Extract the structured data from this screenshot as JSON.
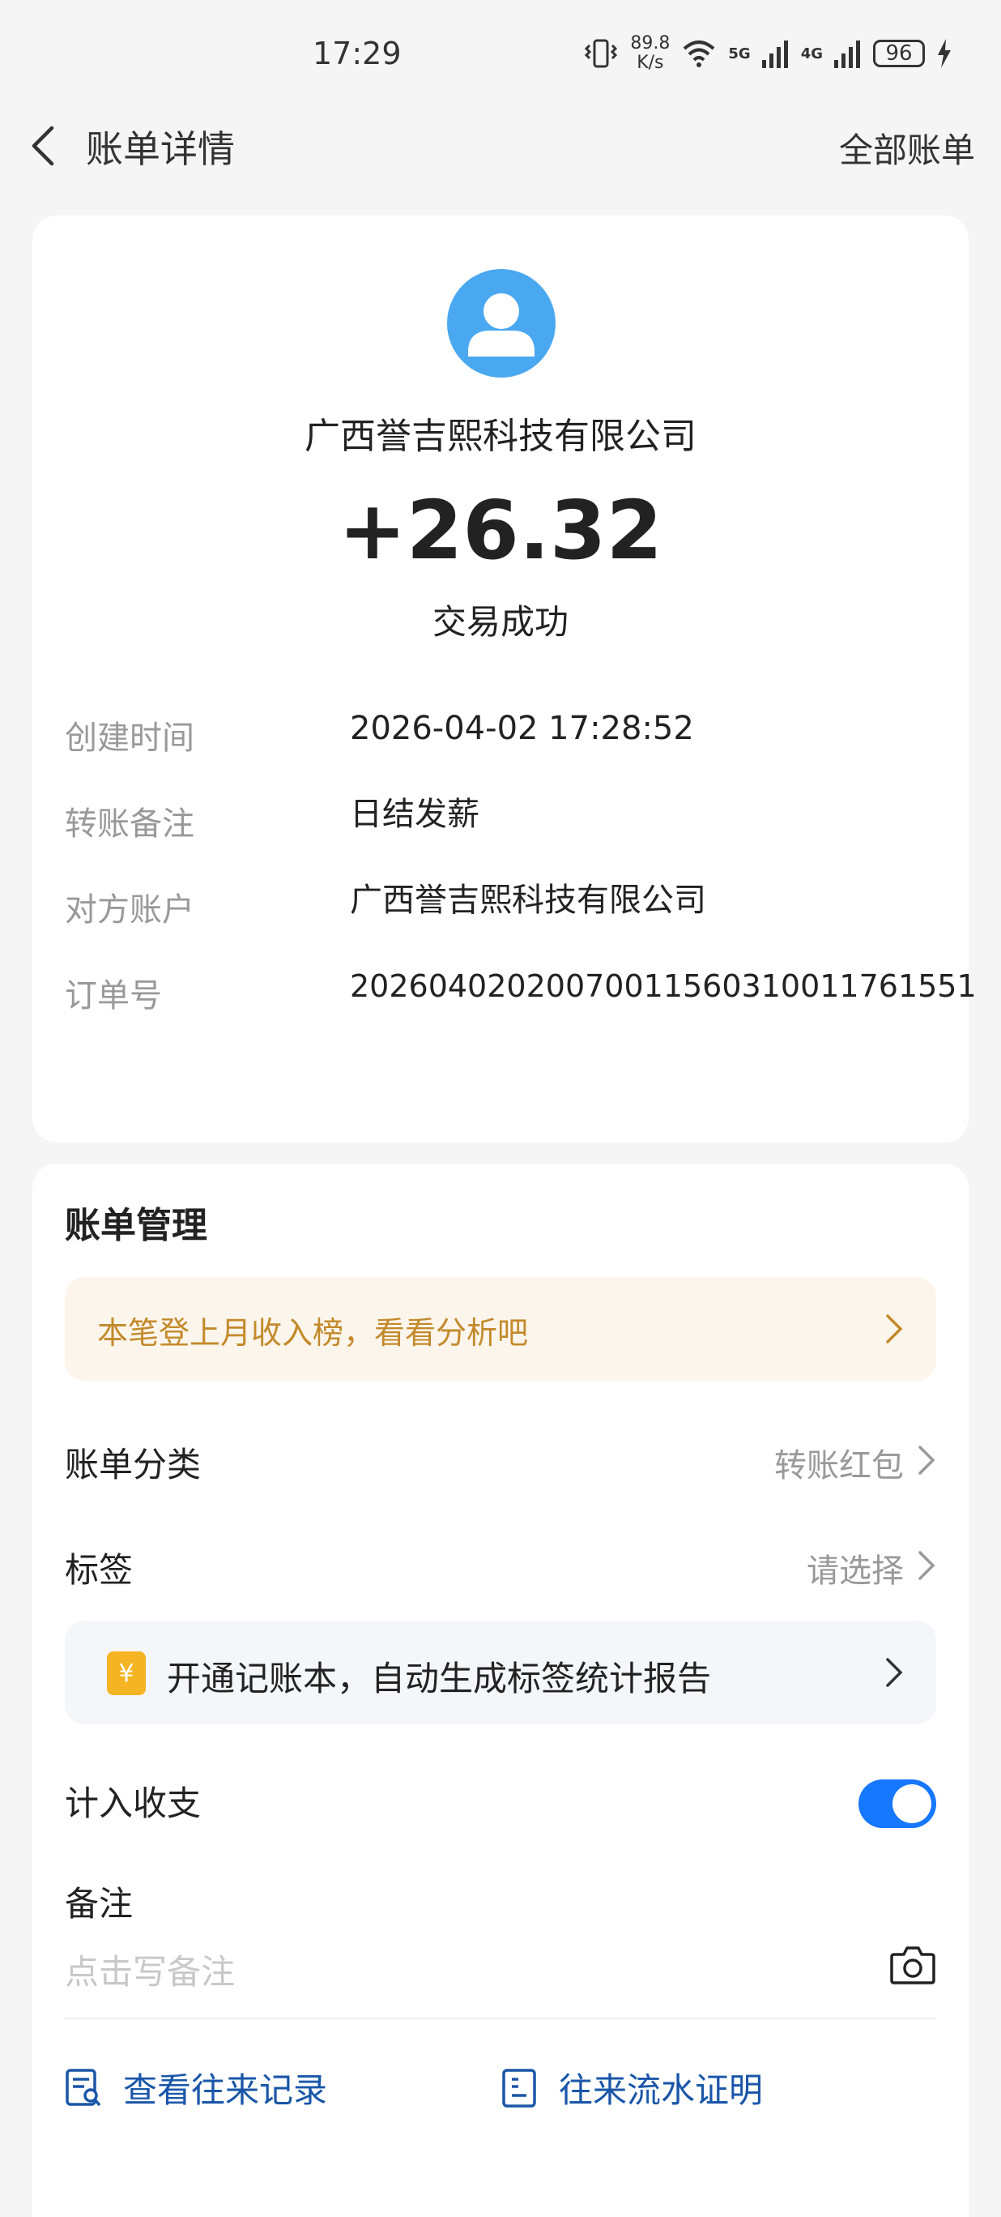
{
  "status_bar": {
    "time": "17:29",
    "speed_value": "89.8",
    "speed_unit": "K/s",
    "net1": "5G",
    "net2": "4G",
    "battery": "96"
  },
  "header": {
    "title": "账单详情",
    "right_action": "全部账单"
  },
  "transaction": {
    "counterparty": "广西誉吉熙科技有限公司",
    "amount": "+26.32",
    "status": "交易成功"
  },
  "details": [
    {
      "label": "创建时间",
      "value": "2026-04-02 17:28:52"
    },
    {
      "label": "转账备注",
      "value": "日结发薪"
    },
    {
      "label": "对方账户",
      "value": "广西誉吉熙科技有限公司"
    },
    {
      "label": "订单号",
      "value": "20260402020070011560310011761551"
    }
  ],
  "management": {
    "title": "账单管理",
    "promo_text": "本笔登上月收入榜，看看分析吧",
    "category_label": "账单分类",
    "category_value": "转账红包",
    "tag_label": "标签",
    "tag_value": "请选择",
    "ledger_text": "开通记账本，自动生成标签统计报告",
    "ledger_icon": "¥",
    "include_label": "计入收支",
    "include_on": true,
    "note_label": "备注",
    "note_placeholder": "点击写备注",
    "link_records": "查看往来记录",
    "link_certificate": "往来流水证明"
  },
  "colors": {
    "accent": "#1677ff",
    "link": "#1a56a8",
    "promo_text": "#c38a2b",
    "avatar": "#4aa8f0"
  },
  "icons": [
    "back-icon",
    "avatar-icon",
    "chevron-right-icon",
    "ledger-icon",
    "camera-icon",
    "records-icon",
    "certificate-icon"
  ]
}
